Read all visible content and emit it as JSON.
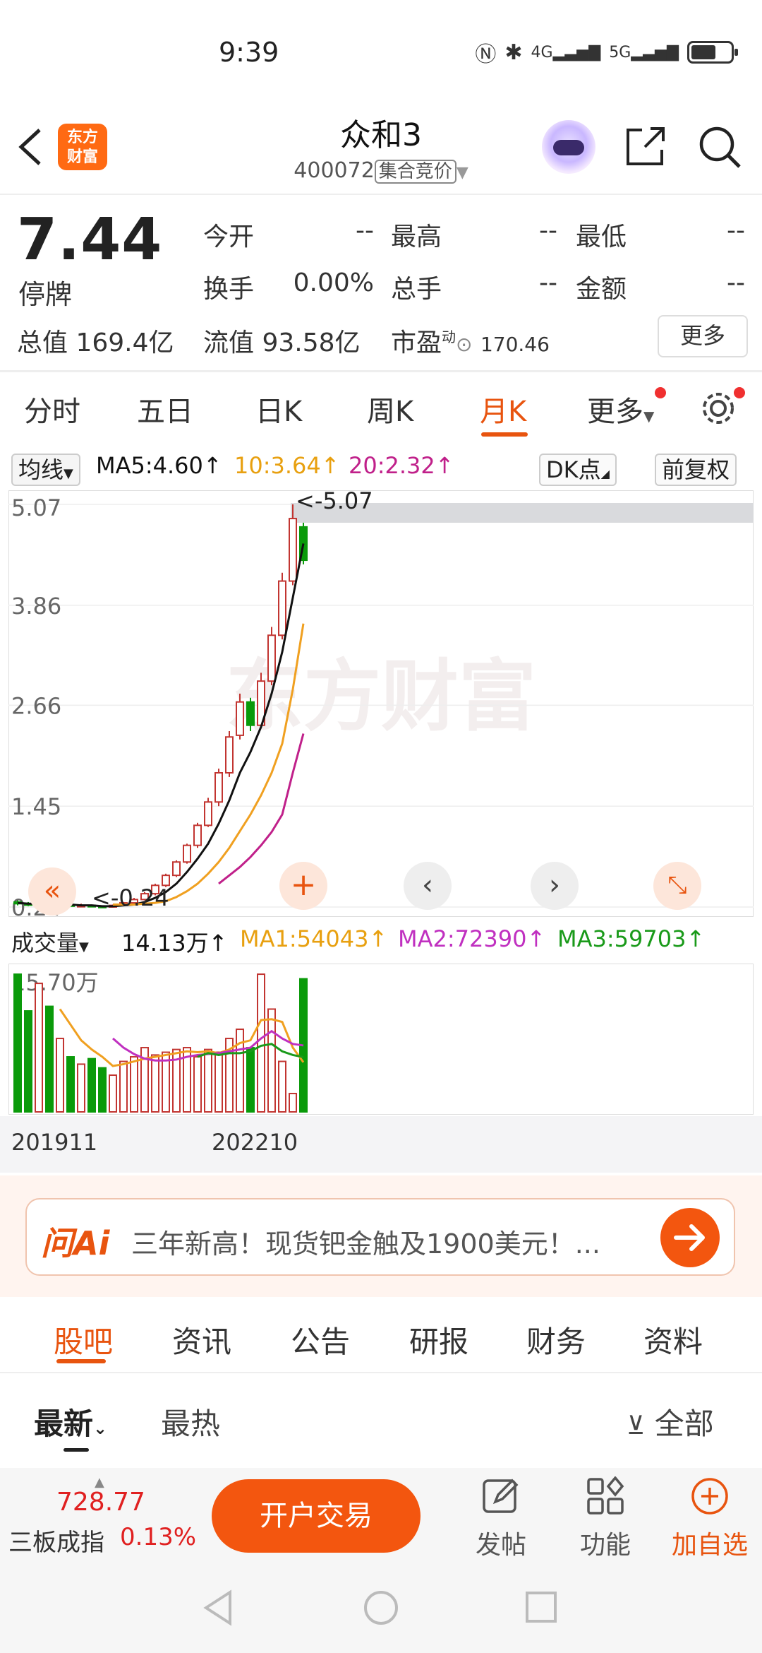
{
  "status": {
    "time": "9:39",
    "net1": "4G",
    "net2": "5G"
  },
  "header": {
    "logo": "东方\n财富",
    "title": "众和3",
    "code": "400072",
    "auction_badge": "集合竞价"
  },
  "quote": {
    "price": "7.44",
    "status": "停牌",
    "fields": [
      {
        "label": "今开",
        "value": "--"
      },
      {
        "label": "最高",
        "value": "--"
      },
      {
        "label": "最低",
        "value": "--"
      },
      {
        "label": "换手",
        "value": "0.00%"
      },
      {
        "label": "总手",
        "value": "--"
      },
      {
        "label": "金额",
        "value": "--"
      }
    ],
    "total_value_label": "总值",
    "total_value": "169.4亿",
    "float_value_label": "流值",
    "float_value": "93.58亿",
    "pe_label": "市盈",
    "pe_sup": "动",
    "pe_value": "170.46",
    "more": "更多"
  },
  "tabs": [
    "分时",
    "五日",
    "日K",
    "周K",
    "月K",
    "更多"
  ],
  "active_tab": "月K",
  "ma": {
    "selector": "均线",
    "ma5": "MA5:4.60↑",
    "ma10": "10:3.64↑",
    "ma20": "20:2.32↑",
    "dk": "DK点",
    "fq": "前复权"
  },
  "volume": {
    "selector": "成交量",
    "vol": "14.13万↑",
    "ma1": "MA1:54043↑",
    "ma2": "MA2:72390↑",
    "ma3": "MA3:59703↑",
    "top_label": "15.70万"
  },
  "colors": {
    "accent": "#e8540f",
    "up": "#c23531",
    "down": "#0a9a0a",
    "ma5": "#111111",
    "ma10": "#f0a020",
    "ma20": "#c0208a",
    "vol_ma2": "#c030c0",
    "vol_ma3": "#1a9a1a"
  },
  "chart_data": {
    "type": "candlestick",
    "yticks": [
      "5.07",
      "3.86",
      "2.66",
      "1.45",
      "0.24"
    ],
    "ylim": [
      0.24,
      5.07
    ],
    "max_label": "<-5.07",
    "min_label": "<-0.24",
    "x_labels": [
      "201911",
      "202210"
    ],
    "watermark": "东方财富",
    "candles": [
      {
        "o": 0.3,
        "c": 0.28,
        "h": 0.32,
        "l": 0.26
      },
      {
        "o": 0.28,
        "c": 0.27,
        "h": 0.3,
        "l": 0.25
      },
      {
        "o": 0.27,
        "c": 0.28,
        "h": 0.3,
        "l": 0.25
      },
      {
        "o": 0.28,
        "c": 0.26,
        "h": 0.29,
        "l": 0.24
      },
      {
        "o": 0.26,
        "c": 0.27,
        "h": 0.29,
        "l": 0.24
      },
      {
        "o": 0.27,
        "c": 0.25,
        "h": 0.28,
        "l": 0.24
      },
      {
        "o": 0.25,
        "c": 0.26,
        "h": 0.28,
        "l": 0.24
      },
      {
        "o": 0.26,
        "c": 0.25,
        "h": 0.27,
        "l": 0.24
      },
      {
        "o": 0.25,
        "c": 0.24,
        "h": 0.26,
        "l": 0.24
      },
      {
        "o": 0.24,
        "c": 0.26,
        "h": 0.27,
        "l": 0.24
      },
      {
        "o": 0.26,
        "c": 0.29,
        "h": 0.3,
        "l": 0.25
      },
      {
        "o": 0.29,
        "c": 0.33,
        "h": 0.35,
        "l": 0.28
      },
      {
        "o": 0.33,
        "c": 0.4,
        "h": 0.42,
        "l": 0.32
      },
      {
        "o": 0.4,
        "c": 0.5,
        "h": 0.52,
        "l": 0.38
      },
      {
        "o": 0.5,
        "c": 0.62,
        "h": 0.64,
        "l": 0.48
      },
      {
        "o": 0.62,
        "c": 0.78,
        "h": 0.8,
        "l": 0.6
      },
      {
        "o": 0.78,
        "c": 0.98,
        "h": 1.0,
        "l": 0.76
      },
      {
        "o": 0.98,
        "c": 1.22,
        "h": 1.25,
        "l": 0.95
      },
      {
        "o": 1.22,
        "c": 1.5,
        "h": 1.55,
        "l": 1.2
      },
      {
        "o": 1.5,
        "c": 1.85,
        "h": 1.9,
        "l": 1.45
      },
      {
        "o": 1.85,
        "c": 2.28,
        "h": 2.35,
        "l": 1.8
      },
      {
        "o": 2.3,
        "c": 2.7,
        "h": 2.8,
        "l": 2.25
      },
      {
        "o": 2.7,
        "c": 2.42,
        "h": 2.75,
        "l": 2.35
      },
      {
        "o": 2.42,
        "c": 2.95,
        "h": 3.05,
        "l": 2.4
      },
      {
        "o": 2.95,
        "c": 3.5,
        "h": 3.6,
        "l": 2.9
      },
      {
        "o": 3.5,
        "c": 4.15,
        "h": 4.25,
        "l": 3.45
      },
      {
        "o": 4.15,
        "c": 4.9,
        "h": 5.07,
        "l": 4.1
      },
      {
        "o": 4.8,
        "c": 4.4,
        "h": 4.85,
        "l": 4.35
      }
    ],
    "ma5": [
      0.29,
      0.28,
      0.28,
      0.28,
      0.27,
      0.27,
      0.26,
      0.26,
      0.25,
      0.25,
      0.26,
      0.27,
      0.3,
      0.35,
      0.42,
      0.52,
      0.66,
      0.82,
      1.0,
      1.24,
      1.52,
      1.85,
      2.1,
      2.4,
      2.8,
      3.3,
      3.95,
      4.6
    ],
    "ma10": [
      null,
      null,
      null,
      null,
      null,
      null,
      null,
      null,
      null,
      0.27,
      0.27,
      0.27,
      0.28,
      0.29,
      0.31,
      0.36,
      0.43,
      0.52,
      0.64,
      0.78,
      0.95,
      1.15,
      1.35,
      1.58,
      1.85,
      2.2,
      2.85,
      3.64
    ],
    "ma20": [
      null,
      null,
      null,
      null,
      null,
      null,
      null,
      null,
      null,
      null,
      null,
      null,
      null,
      null,
      null,
      null,
      null,
      null,
      null,
      0.52,
      0.62,
      0.72,
      0.84,
      0.98,
      1.14,
      1.35,
      1.85,
      2.32
    ],
    "vol": [
      150000,
      110000,
      140000,
      115000,
      80000,
      60000,
      52000,
      58000,
      48000,
      40000,
      55000,
      60000,
      70000,
      62000,
      65000,
      68000,
      70000,
      60000,
      68000,
      65000,
      80000,
      90000,
      70000,
      150000,
      112000,
      55000,
      20000,
      145000
    ],
    "vol_ma1": [
      null,
      null,
      null,
      null,
      112000,
      95000,
      78000,
      68000,
      60000,
      50000,
      52000,
      55000,
      58000,
      60000,
      62000,
      64000,
      66000,
      65000,
      66000,
      64000,
      68000,
      75000,
      78000,
      100000,
      101000,
      98000,
      70000,
      54043
    ],
    "vol_ma2": [
      null,
      null,
      null,
      null,
      null,
      null,
      null,
      null,
      null,
      80000,
      70000,
      63000,
      58000,
      56000,
      56000,
      57000,
      60000,
      62000,
      63000,
      64000,
      66000,
      68000,
      70000,
      80000,
      88000,
      80000,
      74000,
      72390
    ],
    "vol_ma3": [
      null,
      null,
      null,
      null,
      null,
      null,
      null,
      null,
      null,
      null,
      null,
      null,
      null,
      null,
      null,
      null,
      null,
      60000,
      64000,
      62000,
      64000,
      64000,
      66000,
      72000,
      74000,
      66000,
      62000,
      59703
    ],
    "vol_max": 157000
  },
  "promo": {
    "brand": "问Ai",
    "text": "三年新高！现货钯金触及1900美元！..."
  },
  "bottom_tabs": [
    "股吧",
    "资讯",
    "公告",
    "研报",
    "财务",
    "资料"
  ],
  "sort": {
    "latest": "最新",
    "hot": "最热",
    "filter": "全部"
  },
  "index": {
    "value": "728.77",
    "name": "三板成指",
    "pct": "0.13%"
  },
  "bottom_bar": {
    "trade": "开户交易",
    "post": "发帖",
    "func": "功能",
    "watch": "加自选"
  }
}
